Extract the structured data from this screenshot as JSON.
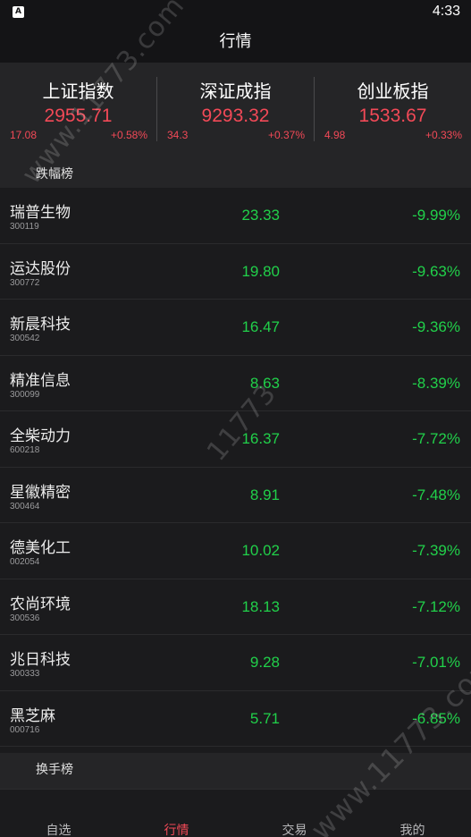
{
  "status_bar": {
    "time": "4:33",
    "app_icon_glyph": "A"
  },
  "header": {
    "title": "行情"
  },
  "indices": [
    {
      "name": "上证指数",
      "value": "2955.71",
      "change": "17.08",
      "pct": "+0.58%"
    },
    {
      "name": "深证成指",
      "value": "9293.32",
      "change": "34.3",
      "pct": "+0.37%"
    },
    {
      "name": "创业板指",
      "value": "1533.67",
      "change": "4.98",
      "pct": "+0.33%"
    }
  ],
  "sections": {
    "losers_title": "跌幅榜",
    "turnover_title": "换手榜"
  },
  "stocks": [
    {
      "name": "瑞普生物",
      "code": "300119",
      "price": "23.33",
      "pct": "-9.99%"
    },
    {
      "name": "运达股份",
      "code": "300772",
      "price": "19.80",
      "pct": "-9.63%"
    },
    {
      "name": "新晨科技",
      "code": "300542",
      "price": "16.47",
      "pct": "-9.36%"
    },
    {
      "name": "精准信息",
      "code": "300099",
      "price": "8.63",
      "pct": "-8.39%"
    },
    {
      "name": "全柴动力",
      "code": "600218",
      "price": "16.37",
      "pct": "-7.72%"
    },
    {
      "name": "星徽精密",
      "code": "300464",
      "price": "8.91",
      "pct": "-7.48%"
    },
    {
      "name": "德美化工",
      "code": "002054",
      "price": "10.02",
      "pct": "-7.39%"
    },
    {
      "name": "农尚环境",
      "code": "300536",
      "price": "18.13",
      "pct": "-7.12%"
    },
    {
      "name": "兆日科技",
      "code": "300333",
      "price": "9.28",
      "pct": "-7.01%"
    },
    {
      "name": "黑芝麻",
      "code": "000716",
      "price": "5.71",
      "pct": "-6.85%"
    }
  ],
  "tabs": [
    {
      "label": "自选",
      "active": false
    },
    {
      "label": "行情",
      "active": true
    },
    {
      "label": "交易",
      "active": false
    },
    {
      "label": "我的",
      "active": false
    }
  ],
  "watermarks": [
    "www.11773.com",
    "11773",
    "www.11773.com"
  ],
  "colors": {
    "up": "#f24957",
    "down": "#21d04a",
    "active_tab": "#f24957",
    "background": "#1b1b1d"
  }
}
